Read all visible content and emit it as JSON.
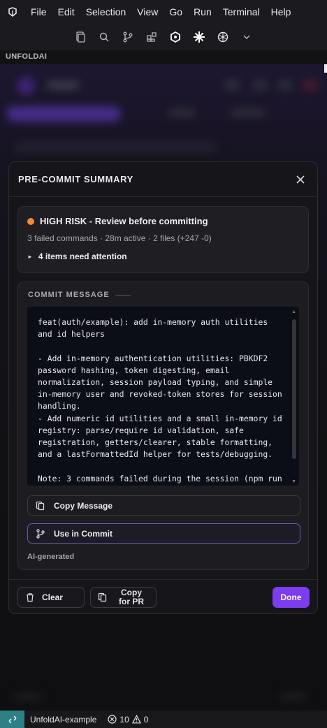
{
  "menu": {
    "items": [
      "File",
      "Edit",
      "Selection",
      "View",
      "Go",
      "Run",
      "Terminal",
      "Help"
    ]
  },
  "toolbar": {
    "icons": [
      "files-icon",
      "search-icon",
      "source-control-icon",
      "extensions-icon",
      "ai-agent-icon",
      "sparkle-icon",
      "openai-icon",
      "chevron-down-icon"
    ]
  },
  "sidebar": {
    "section_title": "UNFOLDAI"
  },
  "modal": {
    "title": "PRE-COMMIT SUMMARY",
    "risk": {
      "level_color": "#f08a3c",
      "title": "HIGH RISK - Review before committing",
      "meta": "3 failed commands · 28m active · 2 files (+247 -0)",
      "attention": "4 items need attention"
    },
    "commit": {
      "label": "COMMIT MESSAGE",
      "message": "feat(auth/example): add in-memory auth utilities and id helpers\n\n- Add in-memory authentication utilities: PBKDF2 password hashing, token digesting, email normalization, session payload typing, and simple in-memory user and revoked-token stores for session handling.\n- Add numeric id utilities and a small in-memory id registry: parse/require id validation, safe registration, getters/clearer, stable formatting, and a lastFormattedId helper for tests/debugging.\n\nNote: 3 commands failed during the session (npm run",
      "copy_label": "Copy Message",
      "use_label": "Use in Commit",
      "ai_note": "AI-generated"
    },
    "footer": {
      "clear_label": "Clear",
      "copy_pr_label": "Copy for PR",
      "done_label": "Done"
    }
  },
  "statusbar": {
    "project": "UnfoldAI-example",
    "errors": "10",
    "warnings": "0"
  },
  "colors": {
    "accent": "#7c3cf0",
    "commit_border": "#6c5aa8",
    "remote": "#2f7f86"
  }
}
